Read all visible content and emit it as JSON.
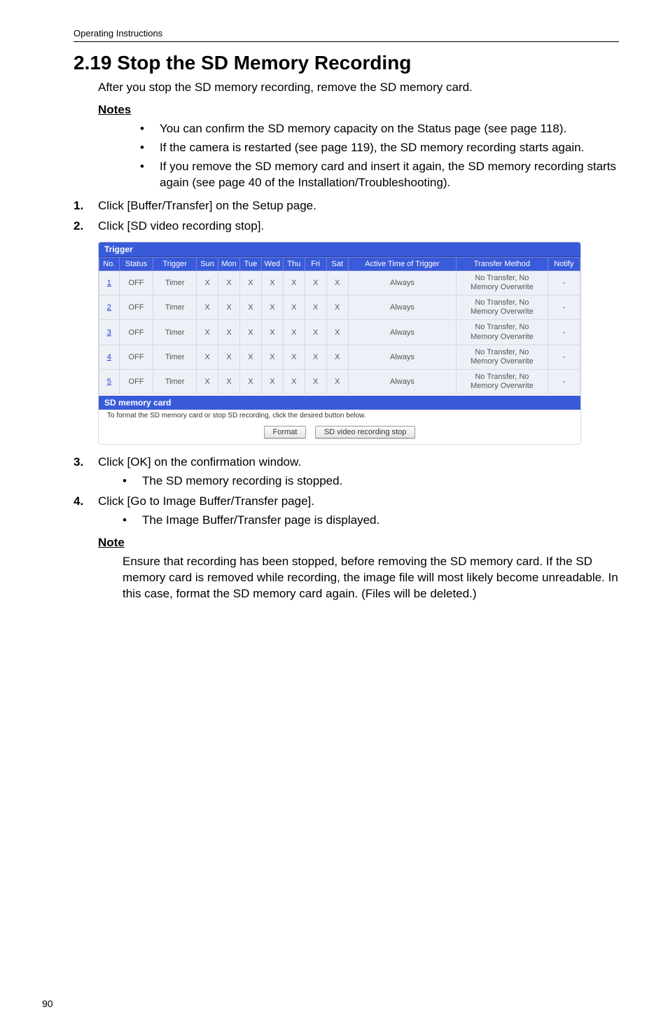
{
  "runhead": "Operating Instructions",
  "title": "2.19  Stop the SD Memory Recording",
  "intro": "After you stop the SD memory recording, remove the SD memory card.",
  "notes_label": "Notes",
  "notes": [
    "You can confirm the SD memory capacity on the Status page (see page 118).",
    "If the camera is restarted (see page 119), the SD memory recording starts again.",
    "If you remove the SD memory card and insert it again, the SD memory recording starts again (see page 40 of the Installation/Troubleshooting)."
  ],
  "steps12": [
    {
      "n": "1.",
      "t": "Click [Buffer/Transfer] on the Setup page."
    },
    {
      "n": "2.",
      "t": "Click [SD video recording stop]."
    }
  ],
  "screenshot": {
    "title": "Trigger",
    "headers": [
      "No.",
      "Status",
      "Trigger",
      "Sun",
      "Mon",
      "Tue",
      "Wed",
      "Thu",
      "Fri",
      "Sat",
      "Active Time of Trigger",
      "Transfer Method",
      "Notify"
    ],
    "row": {
      "status": "OFF",
      "trigger": "Timer",
      "mark": "X",
      "active": "Always",
      "xfer1": "No Transfer, No",
      "xfer2": "Memory Overwrite",
      "notify": "-"
    },
    "row_ids": [
      "1",
      "2",
      "3",
      "4",
      "5"
    ],
    "sub_title": "SD memory card",
    "sub_note": "To format the SD memory card or stop SD recording, click the desired button below.",
    "btn_format": "Format",
    "btn_stop": "SD video recording stop"
  },
  "steps34": [
    {
      "n": "3.",
      "t": "Click [OK] on the confirmation window.",
      "sub": [
        "The SD memory recording is stopped."
      ]
    },
    {
      "n": "4.",
      "t": "Click [Go to Image Buffer/Transfer page].",
      "sub": [
        "The Image Buffer/Transfer page is displayed."
      ]
    }
  ],
  "note_label": "Note",
  "note_body": "Ensure that recording has been stopped, before removing the SD memory card. If the SD memory card is removed while recording, the image file will most likely become unreadable. In this case, format the SD memory card again. (Files will be deleted.)",
  "page_number": "90"
}
